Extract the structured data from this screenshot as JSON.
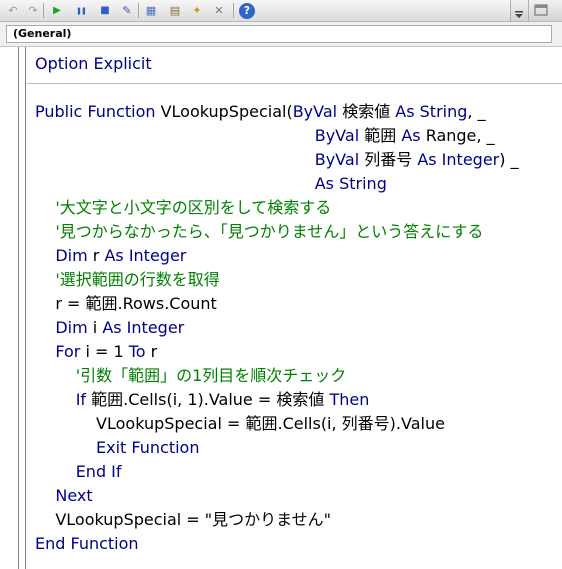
{
  "toolbar": {
    "buttons": [
      {
        "icon": "undo-icon",
        "glyph": "↶",
        "color": "#9a9a9a"
      },
      {
        "icon": "redo-icon",
        "glyph": "↷",
        "color": "#9a9a9a"
      },
      {
        "icon": "run-icon",
        "glyph": "▶",
        "color": "#1fa21f"
      },
      {
        "icon": "break-icon",
        "glyph": "❚❚",
        "color": "#2c5fc9"
      },
      {
        "icon": "reset-icon",
        "glyph": "■",
        "color": "#2c5fc9"
      },
      {
        "icon": "design-mode-icon",
        "glyph": "✎",
        "color": "#3a57b8"
      },
      {
        "icon": "project-explorer-icon",
        "glyph": "▦",
        "color": "#4a6fbf"
      },
      {
        "icon": "properties-window-icon",
        "glyph": "▤",
        "color": "#8a6d3b"
      },
      {
        "icon": "object-browser-icon",
        "glyph": "✦",
        "color": "#c89a1e"
      },
      {
        "icon": "toolbox-icon",
        "glyph": "✕",
        "color": "#7a7a7a"
      },
      {
        "icon": "help-icon",
        "glyph": "?",
        "color": "#ffffff"
      }
    ]
  },
  "procedure_combo": {
    "value": "(General)"
  },
  "code_lines": [
    [
      {
        "t": "Option Explicit",
        "c": "kw"
      }
    ],
    [],
    [
      {
        "t": "Public Function ",
        "c": "kw"
      },
      {
        "t": "VLookupSpecial(",
        "c": "n"
      },
      {
        "t": "ByVal ",
        "c": "kw"
      },
      {
        "t": "検索値 ",
        "c": "n"
      },
      {
        "t": "As String",
        "c": "kw"
      },
      {
        "t": ", _",
        "c": "n"
      }
    ],
    [
      {
        "t": "                                                       ",
        "c": "n"
      },
      {
        "t": "ByVal ",
        "c": "kw"
      },
      {
        "t": "範囲 ",
        "c": "n"
      },
      {
        "t": "As ",
        "c": "kw"
      },
      {
        "t": "Range, _",
        "c": "n"
      }
    ],
    [
      {
        "t": "                                                       ",
        "c": "n"
      },
      {
        "t": "ByVal ",
        "c": "kw"
      },
      {
        "t": "列番号 ",
        "c": "n"
      },
      {
        "t": "As Integer",
        "c": "kw"
      },
      {
        "t": ") _",
        "c": "n"
      }
    ],
    [
      {
        "t": "                                                       ",
        "c": "n"
      },
      {
        "t": "As String",
        "c": "kw"
      }
    ],
    [
      {
        "t": "    ",
        "c": "n"
      },
      {
        "t": "'大文字と小文字の区別をして検索する",
        "c": "cm"
      }
    ],
    [
      {
        "t": "    ",
        "c": "n"
      },
      {
        "t": "'見つからなかったら、「見つかりません」という答えにする",
        "c": "cm"
      }
    ],
    [
      {
        "t": "    ",
        "c": "n"
      },
      {
        "t": "Dim ",
        "c": "kw"
      },
      {
        "t": "r ",
        "c": "n"
      },
      {
        "t": "As Integer",
        "c": "kw"
      }
    ],
    [
      {
        "t": "    ",
        "c": "n"
      },
      {
        "t": "'選択範囲の行数を取得",
        "c": "cm"
      }
    ],
    [
      {
        "t": "    r = 範囲.Rows.Count",
        "c": "n"
      }
    ],
    [
      {
        "t": "    ",
        "c": "n"
      },
      {
        "t": "Dim ",
        "c": "kw"
      },
      {
        "t": "i ",
        "c": "n"
      },
      {
        "t": "As Integer",
        "c": "kw"
      }
    ],
    [
      {
        "t": "    ",
        "c": "n"
      },
      {
        "t": "For ",
        "c": "kw"
      },
      {
        "t": "i = 1 ",
        "c": "n"
      },
      {
        "t": "To ",
        "c": "kw"
      },
      {
        "t": "r",
        "c": "n"
      }
    ],
    [
      {
        "t": "        ",
        "c": "n"
      },
      {
        "t": "'引数「範囲」の1列目を順次チェック",
        "c": "cm"
      }
    ],
    [
      {
        "t": "        ",
        "c": "n"
      },
      {
        "t": "If ",
        "c": "kw"
      },
      {
        "t": "範囲.Cells(i, 1).Value = 検索値 ",
        "c": "n"
      },
      {
        "t": "Then",
        "c": "kw"
      }
    ],
    [
      {
        "t": "            VLookupSpecial = 範囲.Cells(i, 列番号).Value",
        "c": "n"
      }
    ],
    [
      {
        "t": "            ",
        "c": "n"
      },
      {
        "t": "Exit Function",
        "c": "kw"
      }
    ],
    [
      {
        "t": "        ",
        "c": "n"
      },
      {
        "t": "End If",
        "c": "kw"
      }
    ],
    [
      {
        "t": "    ",
        "c": "n"
      },
      {
        "t": "Next",
        "c": "kw"
      }
    ],
    [
      {
        "t": "    VLookupSpecial = \"見つかりません\"",
        "c": "n"
      }
    ],
    [
      {
        "t": "End Function",
        "c": "kw"
      }
    ]
  ]
}
